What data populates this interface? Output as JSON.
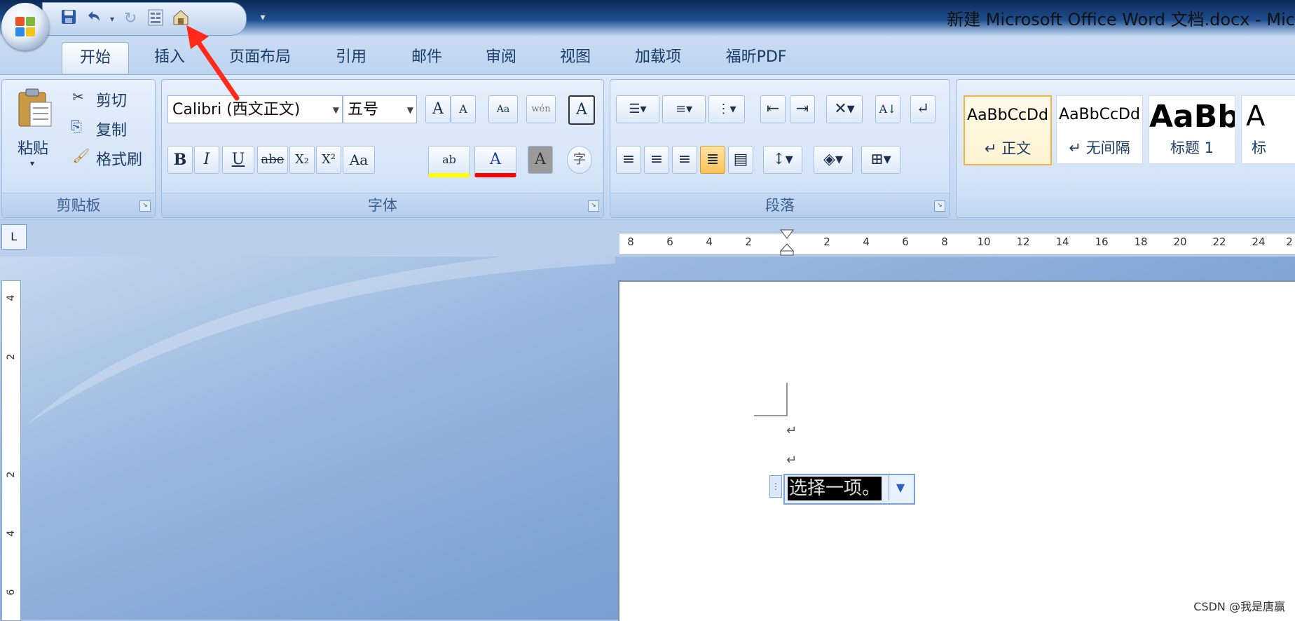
{
  "window": {
    "title": "新建 Microsoft Office Word 文档.docx - Mic",
    "office_button_icon": "office-logo"
  },
  "quick_access": {
    "buttons": [
      "save-icon",
      "undo-icon",
      "undo-dropdown-icon",
      "redo-icon",
      "form-fields-icon",
      "properties-icon"
    ],
    "customize_label": "▾"
  },
  "tabs": [
    {
      "label": "开始",
      "active": true
    },
    {
      "label": "插入",
      "active": false
    },
    {
      "label": "页面布局",
      "active": false
    },
    {
      "label": "引用",
      "active": false
    },
    {
      "label": "邮件",
      "active": false
    },
    {
      "label": "审阅",
      "active": false
    },
    {
      "label": "视图",
      "active": false
    },
    {
      "label": "加载项",
      "active": false
    },
    {
      "label": "福昕PDF",
      "active": false
    }
  ],
  "clipboard": {
    "paste_label": "粘贴",
    "cut_label": "剪切",
    "copy_label": "复制",
    "format_painter_label": "格式刷",
    "group_label": "剪贴板"
  },
  "font": {
    "font_name": "Calibri (西文正文)",
    "font_size": "五号",
    "group_label": "字体",
    "grow_label": "A",
    "shrink_label": "A",
    "clear_label": "Aa",
    "phonetic_label": "wén",
    "border_label": "A",
    "bold_label": "B",
    "italic_label": "I",
    "underline_label": "U",
    "strike_label": "abe",
    "sub_label": "X₂",
    "sup_label": "X²",
    "case_label": "Aa",
    "highlight_label": "ab",
    "color_label": "A",
    "shade_label": "A",
    "enclose_label": "字"
  },
  "paragraph": {
    "group_label": "段落"
  },
  "styles": [
    {
      "sample": "AaBbCcDd",
      "name": "↵ 正文",
      "selected": true
    },
    {
      "sample": "AaBbCcDd",
      "name": "↵ 无间隔",
      "selected": false
    },
    {
      "sample": "AaBb",
      "name": "标题 1",
      "selected": false
    },
    {
      "sample": "A",
      "name": "标",
      "selected": false
    }
  ],
  "ruler": {
    "corner_label": "L",
    "h_numbers": [
      "8",
      "6",
      "4",
      "2",
      "2",
      "4",
      "6",
      "8",
      "10",
      "12",
      "14",
      "16",
      "18",
      "20",
      "22",
      "24",
      "2"
    ],
    "v_numbers": [
      "4",
      "2",
      "2",
      "4",
      "6"
    ]
  },
  "document": {
    "paragraph_marks": [
      "↵",
      "↵"
    ],
    "content_control_text": "选择一项。",
    "content_control_dropdown": "▼",
    "content_control_handle": "⋮"
  },
  "watermark": "CSDN @我是唐赢",
  "colors": {
    "accent_blue": "#1b3a66",
    "highlight_yellow": "#ffff00",
    "font_color_red": "#ff0000",
    "selected_style_border": "#f0b54a",
    "annotation_arrow": "#ff2a1a"
  }
}
